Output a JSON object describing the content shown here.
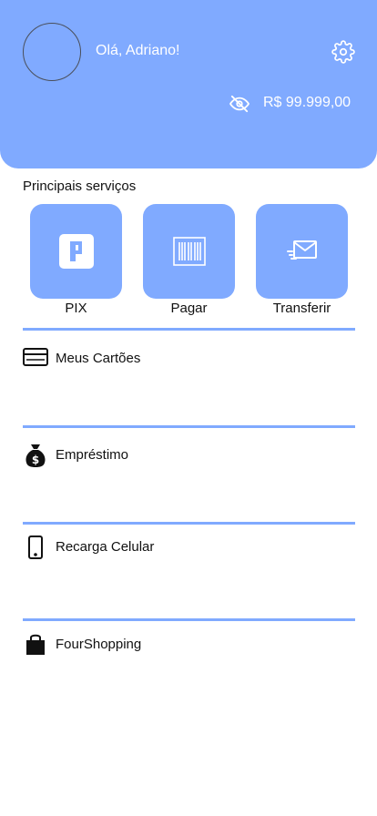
{
  "header": {
    "greeting": "Olá, Adriano!",
    "balance": "R$ 99.999,00",
    "accent_color": "#80aaff",
    "icons": [
      "avatar",
      "gear-icon",
      "eye-off-icon"
    ]
  },
  "services": {
    "title": "Principais serviços",
    "items": [
      {
        "label": "PIX",
        "icon": "pix-icon"
      },
      {
        "label": "Pagar",
        "icon": "barcode-icon"
      },
      {
        "label": "Transferir",
        "icon": "send-mail-icon"
      }
    ]
  },
  "menu": {
    "items": [
      {
        "label": "Meus Cartões",
        "icon": "credit-card-icon"
      },
      {
        "label": "Empréstimo",
        "icon": "money-bag-icon"
      },
      {
        "label": "Recarga Celular",
        "icon": "mobile-phone-icon"
      },
      {
        "label": "FourShopping",
        "icon": "shopping-bag-icon"
      }
    ]
  }
}
